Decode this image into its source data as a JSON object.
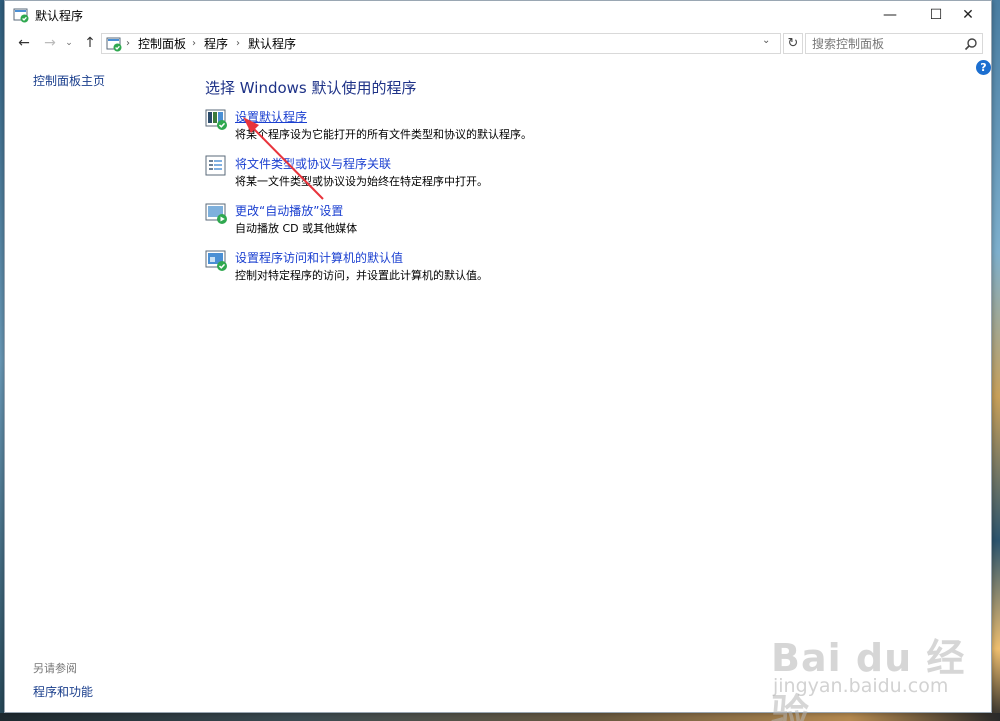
{
  "window": {
    "title": "默认程序",
    "minimize": "—",
    "maximize": "☐",
    "close": "✕"
  },
  "nav": {
    "back": "←",
    "forward": "→",
    "dropdown": "⌄",
    "up": "↑",
    "breadcrumbs": [
      "控制面板",
      "程序",
      "默认程序"
    ],
    "separator": "›",
    "refresh": "↻",
    "search_placeholder": "搜索控制面板"
  },
  "help": "?",
  "sidebar": {
    "home_link": "控制面板主页",
    "see_also_label": "另请参阅",
    "see_also_link": "程序和功能"
  },
  "main": {
    "title": "选择 Windows 默认使用的程序",
    "tasks": [
      {
        "link": "设置默认程序",
        "desc": "将某个程序设为它能打开的所有文件类型和协议的默认程序。",
        "icon": "default-programs-icon"
      },
      {
        "link": "将文件类型或协议与程序关联",
        "desc": "将某一文件类型或协议设为始终在特定程序中打开。",
        "icon": "file-association-icon"
      },
      {
        "link": "更改“自动播放”设置",
        "desc": "自动播放 CD 或其他媒体",
        "icon": "autoplay-icon"
      },
      {
        "link": "设置程序访问和计算机的默认值",
        "desc": "控制对特定程序的访问，并设置此计算机的默认值。",
        "icon": "program-access-icon"
      }
    ]
  },
  "watermark": {
    "logo": "Bai du 经验",
    "url": "jingyan.baidu.com"
  },
  "colors": {
    "link": "#1a3fd0",
    "title": "#1e3287",
    "annotation": "#e8343c"
  }
}
